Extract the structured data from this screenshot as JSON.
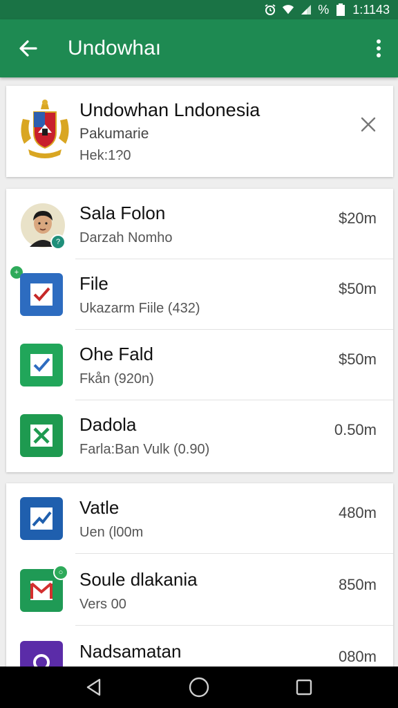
{
  "status_bar": {
    "time": "1:1143",
    "battery_text": "%"
  },
  "app_bar": {
    "title": "Undowhaı"
  },
  "header_card": {
    "title": "Undowhan Lndonesia",
    "subtitle": "Pakumarie",
    "meta": "Hek:1?0"
  },
  "items": [
    {
      "title": "Sala Folon",
      "subtitle": "Darzah Nomho",
      "size": "$20m",
      "icon": "person-avatar-icon"
    },
    {
      "title": "File",
      "subtitle": "Ukazarm Fiile (432)",
      "size": "$50m",
      "icon": "blue-check-icon"
    },
    {
      "title": "Ohe Fald",
      "subtitle": "Fkån (920n)",
      "size": "$50m",
      "icon": "green-check-icon"
    },
    {
      "title": "Dadola",
      "subtitle": "Farla:Ban Vulk  (0.90)",
      "size": "0.50m",
      "icon": "excel-x-icon"
    }
  ],
  "items2": [
    {
      "title": "Vatle",
      "subtitle": "Uen (l00m",
      "size": "480m",
      "icon": "trend-chart-icon"
    },
    {
      "title": "Soule dlakania",
      "subtitle": "Vers 00",
      "size": "850m",
      "icon": "gmail-icon"
    },
    {
      "title": "Nadsamatan",
      "subtitle": "",
      "size": "080m",
      "icon": "purple-app-icon"
    }
  ],
  "colors": {
    "app_bar": "#1e8a52",
    "status_bar": "#1a7345",
    "accent_green": "#2eaa5a",
    "blue": "#2d6cc0"
  }
}
